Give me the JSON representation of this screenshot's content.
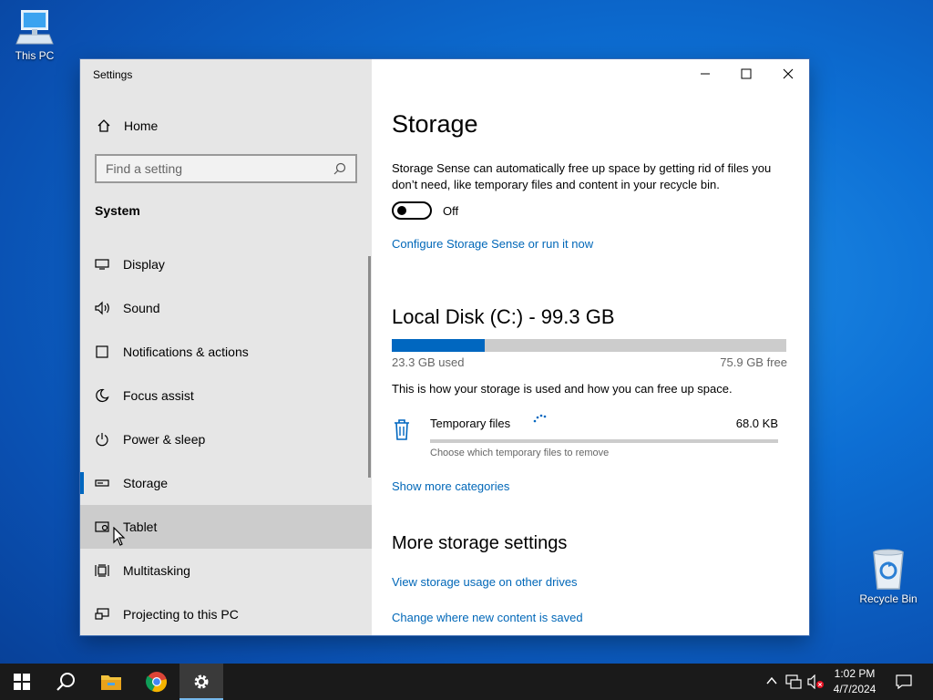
{
  "desktop": {
    "icons": [
      {
        "label": "This PC",
        "icon": "computer-icon"
      },
      {
        "label": "Recycle Bin",
        "icon": "recycle-bin-icon"
      }
    ]
  },
  "window": {
    "title": "Settings",
    "controls": {
      "minimize": "minimize-icon",
      "maximize": "maximize-icon",
      "close": "close-icon"
    }
  },
  "sidebar": {
    "home_label": "Home",
    "search_placeholder": "Find a setting",
    "section_label": "System",
    "items": [
      {
        "label": "Display",
        "icon": "display-icon"
      },
      {
        "label": "Sound",
        "icon": "sound-icon"
      },
      {
        "label": "Notifications & actions",
        "icon": "notifications-icon"
      },
      {
        "label": "Focus assist",
        "icon": "moon-icon"
      },
      {
        "label": "Power & sleep",
        "icon": "power-icon"
      },
      {
        "label": "Storage",
        "icon": "storage-icon",
        "selected": true
      },
      {
        "label": "Tablet",
        "icon": "tablet-icon",
        "hovered": true
      },
      {
        "label": "Multitasking",
        "icon": "multitasking-icon"
      },
      {
        "label": "Projecting to this PC",
        "icon": "projecting-icon"
      }
    ]
  },
  "storage": {
    "title": "Storage",
    "description": "Storage Sense can automatically free up space by getting rid of files you don’t need, like temporary files and content in your recycle bin.",
    "toggle_state": "Off",
    "configure_link": "Configure Storage Sense or run it now",
    "disk_title": "Local Disk (C:) - 99.3 GB",
    "used_label": "23.3 GB used",
    "free_label": "75.9 GB free",
    "used_fraction": 0.235,
    "usage_text": "This is how your storage is used and how you can free up space.",
    "category": {
      "label": "Temporary files",
      "size": "68.0 KB",
      "hint": "Choose which temporary files to remove",
      "fill_fraction": 0.0
    },
    "show_more_link": "Show more categories",
    "more_title": "More storage settings",
    "links": [
      "View storage usage on other drives",
      "Change where new content is saved"
    ]
  },
  "taskbar": {
    "apps": [
      "windows-start-icon",
      "search-icon",
      "file-explorer-icon",
      "chrome-icon",
      "settings-gear-icon"
    ],
    "time": "1:02 PM",
    "date": "4/7/2024"
  }
}
